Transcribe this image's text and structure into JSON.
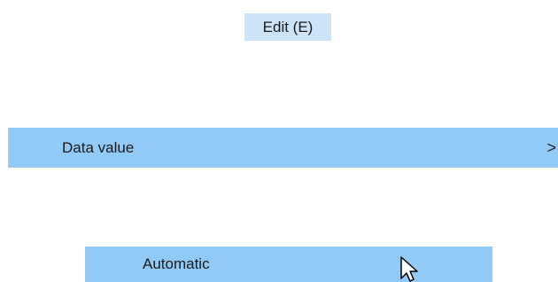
{
  "menu": {
    "edit_label": "Edit (E)",
    "data_value_label": "Data value",
    "data_value_arrow": ">"
  },
  "submenu": {
    "automatic_label": "Automatic"
  },
  "icons": {
    "cursor": "mouse-pointer-icon"
  },
  "colors": {
    "tab_highlight": "#cce4f7",
    "row_highlight": "#91c9f7"
  }
}
